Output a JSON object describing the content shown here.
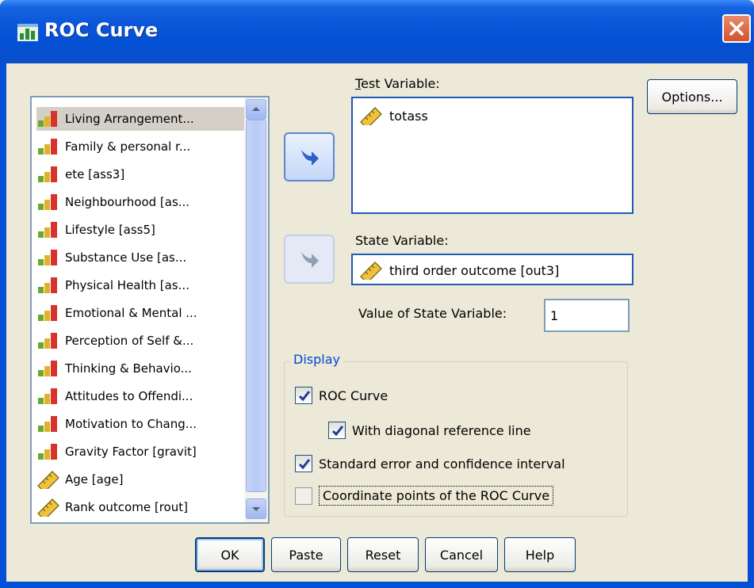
{
  "window": {
    "title": "ROC Curve"
  },
  "variables": [
    {
      "label": "Living Arrangement...",
      "type": "ordinal",
      "selected": true
    },
    {
      "label": "Family & personal r...",
      "type": "ordinal"
    },
    {
      "label": "ete [ass3]",
      "type": "ordinal"
    },
    {
      "label": "Neighbourhood [as...",
      "type": "ordinal"
    },
    {
      "label": "Lifestyle [ass5]",
      "type": "ordinal"
    },
    {
      "label": "Substance Use [as...",
      "type": "ordinal"
    },
    {
      "label": "Physical Health [as...",
      "type": "ordinal"
    },
    {
      "label": "Emotional & Mental ...",
      "type": "ordinal"
    },
    {
      "label": "Perception of Self &...",
      "type": "ordinal"
    },
    {
      "label": "Thinking & Behavio...",
      "type": "ordinal"
    },
    {
      "label": "Attitudes to Offendi...",
      "type": "ordinal"
    },
    {
      "label": "Motivation to Chang...",
      "type": "ordinal"
    },
    {
      "label": "Gravity Factor [gravit]",
      "type": "ordinal"
    },
    {
      "label": "Age [age]",
      "type": "scale"
    },
    {
      "label": "Rank outcome [rout]",
      "type": "scale"
    }
  ],
  "test_variable": {
    "label": "Test Variable:",
    "value": "totass"
  },
  "state_variable": {
    "label": "State Variable:",
    "value": "third order outcome [out3]"
  },
  "value_of_state": {
    "label": "Value of State Variable:",
    "value": "1"
  },
  "display": {
    "title": "Display",
    "options": [
      {
        "label": "ROC Curve",
        "checked": true
      },
      {
        "label": "With diagonal reference line",
        "checked": true
      },
      {
        "label": "Standard error and confidence interval",
        "checked": true
      },
      {
        "label": "Coordinate points of the ROC Curve",
        "checked": false
      }
    ]
  },
  "buttons": {
    "options": "Options...",
    "ok": "OK",
    "paste": "Paste",
    "reset": "Reset",
    "cancel": "Cancel",
    "help": "Help"
  },
  "colors": {
    "titlebar": "#0a55d8",
    "accent": "#0046d5",
    "face": "#ece9d8"
  }
}
